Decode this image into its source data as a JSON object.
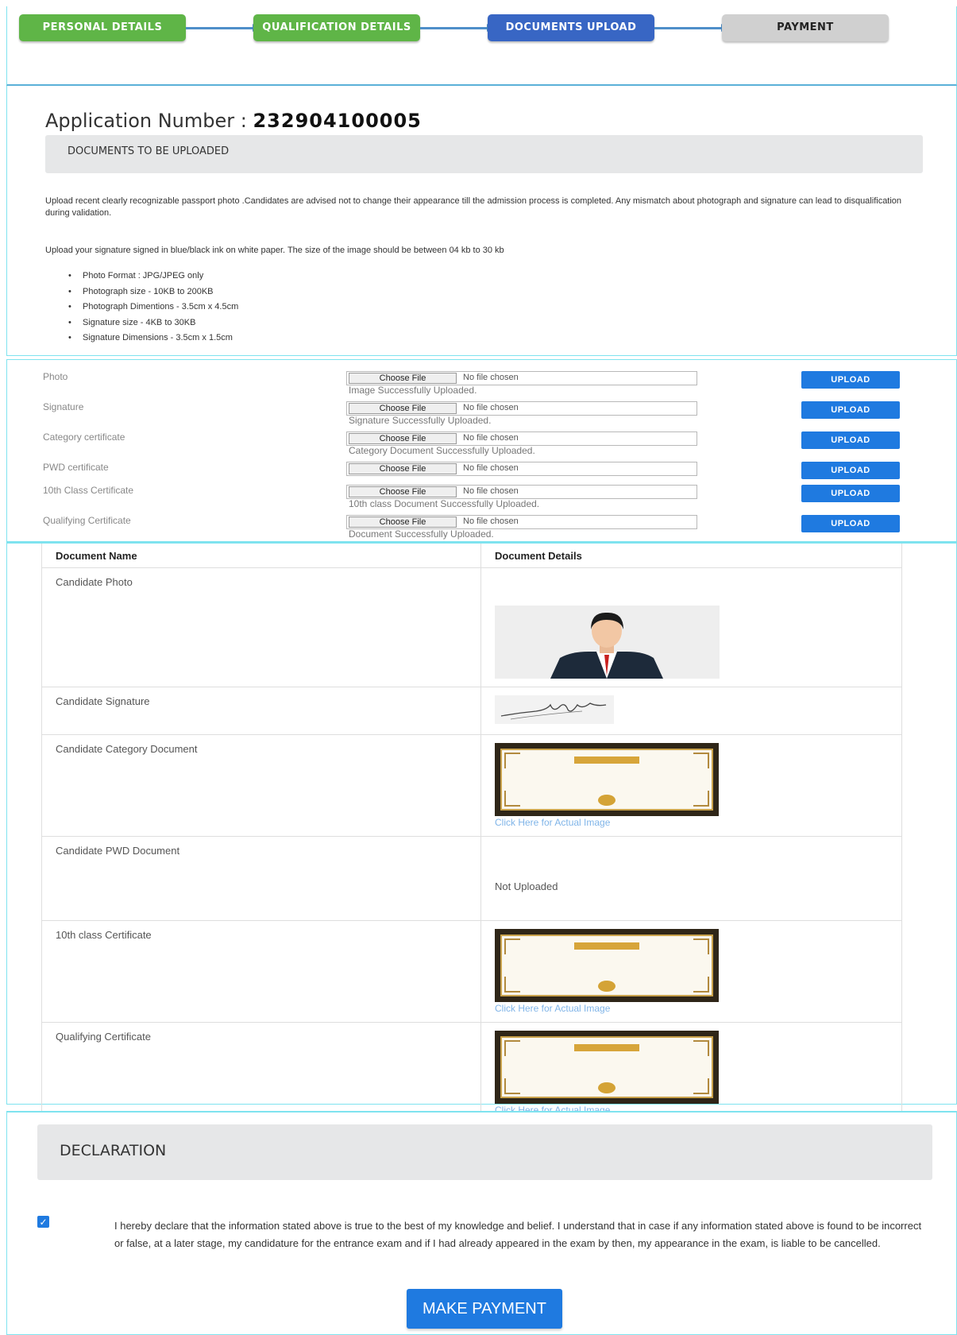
{
  "stepper": {
    "steps": [
      {
        "label": "PERSONAL DETAILS"
      },
      {
        "label": "QUALIFICATION DETAILS"
      },
      {
        "label": "DOCUMENTS UPLOAD"
      },
      {
        "label": "PAYMENT"
      }
    ]
  },
  "application": {
    "number_label": "Application Number : ",
    "number_value": "232904100005"
  },
  "documents_section": {
    "title": "DOCUMENTS TO BE UPLOADED",
    "para1": "Upload recent clearly recognizable passport photo .Candidates are advised not to change their appearance till the admission process is completed. Any mismatch about photograph and signature can lead to disqualification during validation.",
    "para2": "Upload your signature signed in blue/black ink on white paper. The size of the image should be between 04 kb to 30 kb",
    "bullets": [
      "Photo Format : JPG/JPEG only",
      "Photograph size - 10KB to 200KB",
      "Photograph Dimentions - 3.5cm x 4.5cm",
      "Signature size - 4KB to 30KB",
      "Signature Dimensions - 3.5cm x 1.5cm"
    ]
  },
  "uploads": {
    "choose_label": "Choose File",
    "no_file_label": "No file chosen",
    "upload_label": "UPLOAD",
    "rows": [
      {
        "label": "Photo",
        "status": "Image Successfully Uploaded."
      },
      {
        "label": "Signature",
        "status": "Signature Successfully Uploaded."
      },
      {
        "label": "Category certificate",
        "status": "Category Document Successfully Uploaded."
      },
      {
        "label": "PWD certificate",
        "status": ""
      },
      {
        "label": "10th Class Certificate",
        "status": "10th class Document Successfully Uploaded."
      },
      {
        "label": "Qualifying Certificate",
        "status": "Document Successfully Uploaded."
      }
    ]
  },
  "doc_table": {
    "headers": [
      "Document Name",
      "Document Details"
    ],
    "rows": [
      {
        "name": "Candidate Photo"
      },
      {
        "name": "Candidate Signature"
      },
      {
        "name": "Candidate Category Document",
        "link": "Click Here for Actual Image"
      },
      {
        "name": "Candidate PWD Document",
        "detail_text": "Not Uploaded"
      },
      {
        "name": "10th class Certificate",
        "link": "Click Here for Actual Image"
      },
      {
        "name": "Qualifying Certificate",
        "link": "Click Here for Actual Image"
      }
    ]
  },
  "declaration": {
    "title": "DECLARATION",
    "checked": true,
    "text": "I hereby declare that the information stated above is true to the best of my knowledge and belief. I understand that in case if any information stated above is found to be incorrect or false, at a later stage, my candidature for the entrance exam and if I had already appeared in the exam by then, my appearance in the exam, is liable to be cancelled.",
    "button": "MAKE PAYMENT"
  },
  "colors": {
    "step_done": "#5fb547",
    "step_active": "#3866c4",
    "step_pending": "#d0d0d0",
    "primary_button": "#1f7ae0",
    "panel_border": "#7fe3ef"
  }
}
